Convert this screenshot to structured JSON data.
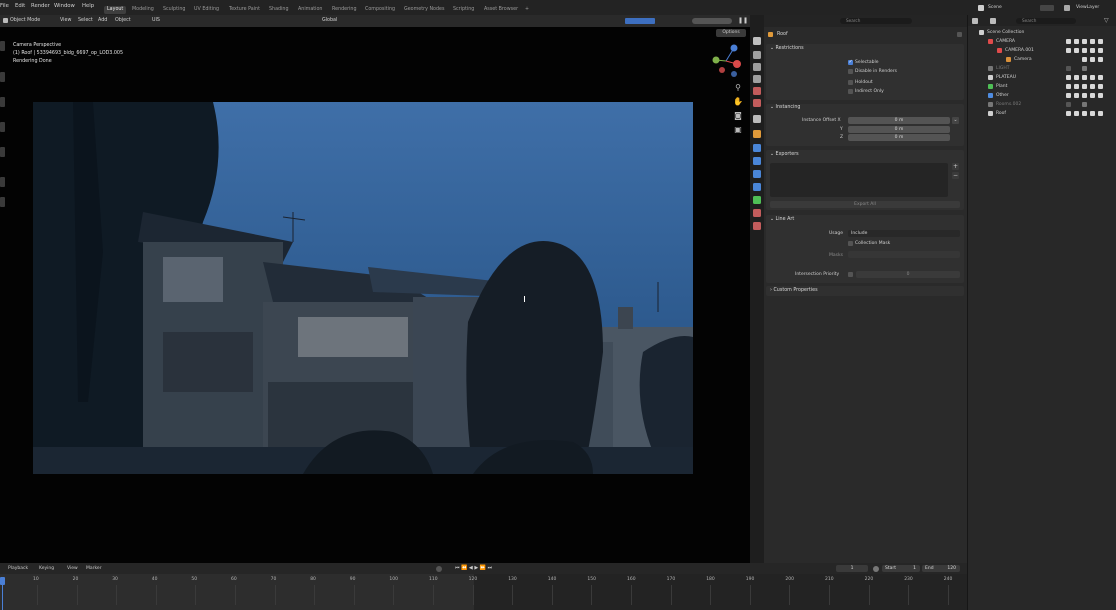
{
  "menu": [
    "File",
    "Edit",
    "Render",
    "Window",
    "Help"
  ],
  "workspaces": [
    {
      "label": "Layout",
      "active": true
    },
    {
      "label": "Modeling"
    },
    {
      "label": "Sculpting"
    },
    {
      "label": "UV Editing"
    },
    {
      "label": "Texture Paint"
    },
    {
      "label": "Shading"
    },
    {
      "label": "Animation"
    },
    {
      "label": "Rendering"
    },
    {
      "label": "Compositing"
    },
    {
      "label": "Geometry Nodes"
    },
    {
      "label": "Scripting"
    },
    {
      "label": "Asset Browser"
    },
    {
      "label": "+"
    }
  ],
  "scene": {
    "scene_name": "Scene",
    "view_layer": "ViewLayer"
  },
  "viewport_header": {
    "mode": "Object Mode",
    "menus": [
      "View",
      "Select",
      "Add",
      "Object"
    ],
    "extra": "UIS",
    "transform": "Global",
    "options": "Options"
  },
  "viewport_overlay": {
    "line1": "Camera Perspective",
    "line2": "(1) Roof | 53394693_bldg_6697_op_LOD3.005",
    "line3": "Rendering Done"
  },
  "properties": {
    "object_name": "Roof",
    "search_placeholder": "Search",
    "restrictions": {
      "title": "Restrictions",
      "selectable": "Selectable",
      "disable_in_renders": "Disable in Renders",
      "holdout": "Holdout",
      "indirect_only": "Indirect Only"
    },
    "instancing": {
      "title": "Instancing",
      "offset_label": "Instance Offset X",
      "y_label": "Y",
      "z_label": "Z",
      "x_value": "0 m",
      "y_value": "0 m",
      "z_value": "0 m"
    },
    "exporters": {
      "title": "Exporters",
      "export_all": "Export All"
    },
    "line_art": {
      "title": "Line Art",
      "usage_label": "Usage",
      "usage_value": "Include",
      "collection_mask": "Collection Mask",
      "masks": "Masks",
      "intersection_priority": "Intersection Priority",
      "intersection_value": "0"
    },
    "custom_properties": "Custom Properties"
  },
  "outliner": {
    "search_placeholder": "Search",
    "rows": [
      {
        "name": "Scene Collection",
        "indent": 0,
        "icon_color": "#cfcfcf"
      },
      {
        "name": "CAMERA",
        "indent": 1,
        "icon_color": "#e04b4b"
      },
      {
        "name": "CAMERA.001",
        "indent": 2,
        "icon_color": "#e04b4b"
      },
      {
        "name": "Camera",
        "indent": 3,
        "icon_color": "#d9903a"
      },
      {
        "name": "LIGHT",
        "indent": 1,
        "icon_color": "#777777",
        "dim": true
      },
      {
        "name": "PLATEAU",
        "indent": 1,
        "icon_color": "#cfcfcf"
      },
      {
        "name": "Plant",
        "indent": 1,
        "icon_color": "#4fbf56"
      },
      {
        "name": "Other",
        "indent": 1,
        "icon_color": "#4f8ce0"
      },
      {
        "name": "Rooms.002",
        "indent": 1,
        "icon_color": "#777777",
        "dim": true
      },
      {
        "name": "Roof",
        "indent": 1,
        "icon_color": "#cfcfcf"
      }
    ]
  },
  "timeline": {
    "menus": [
      "Playback",
      "Keying",
      "View",
      "Marker"
    ],
    "current_frame": "1",
    "start_label": "Start",
    "start": "1",
    "end_label": "End",
    "end": "120",
    "ruler": [
      "10",
      "20",
      "30",
      "40",
      "50",
      "60",
      "70",
      "80",
      "90",
      "100",
      "110",
      "120",
      "130",
      "140",
      "150",
      "160",
      "170",
      "180",
      "190",
      "200",
      "210",
      "220",
      "230",
      "240"
    ]
  }
}
